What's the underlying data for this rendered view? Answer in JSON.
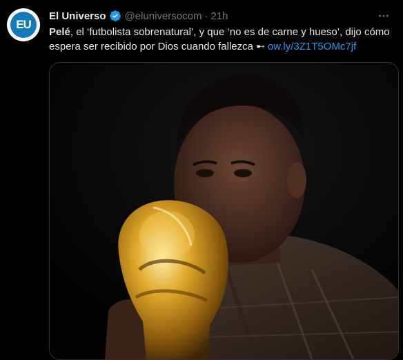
{
  "tweet": {
    "author_name": "El Universo",
    "handle": "@eluniversocom",
    "separator": "·",
    "time": "21h",
    "avatar_text": "EU",
    "text_bold": "Pelé",
    "text_rest": ", el ‘futbolista sobrenatural’, y que ‘no es de carne y hueso’, dijo cómo espera ser recibido por Dios cuando fallezca ➸ ",
    "link": "ow.ly/3Z1T5OMc7jf",
    "more_icon": "more-horizontal-icon",
    "verified_icon": "verified-badge-icon",
    "media_description_icon": "photo"
  },
  "colors": {
    "background": "#000000",
    "text": "#e7e9ea",
    "muted": "#71767b",
    "link": "#1d9bf0",
    "verified": "#1d9bf0",
    "avatar": "#1479b8"
  }
}
